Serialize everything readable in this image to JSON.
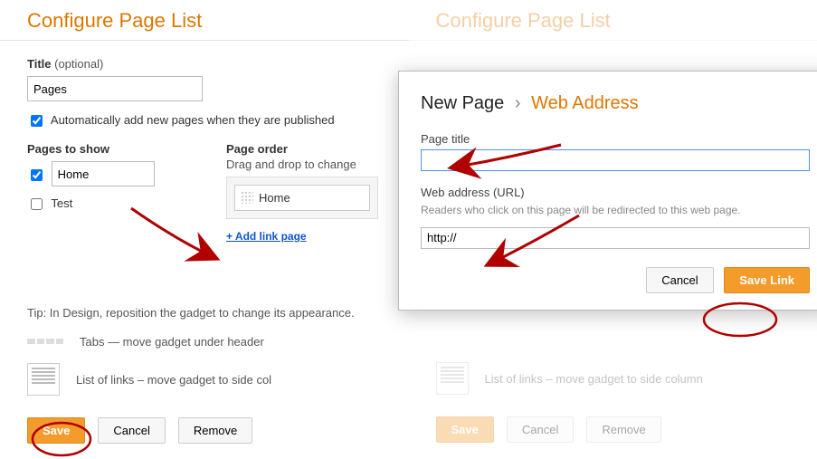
{
  "left": {
    "heading": "Configure Page List",
    "title_label": "Title",
    "title_optional": "(optional)",
    "title_value": "Pages",
    "auto_add_label": "Automatically add new pages when they are published",
    "auto_add_checked": true,
    "pages_to_show_label": "Pages to show",
    "page_order_label": "Page order",
    "page_order_hint": "Drag and drop to change",
    "pages": [
      {
        "name": "Home",
        "checked": true
      },
      {
        "name": "Test",
        "checked": false
      }
    ],
    "order_items": [
      "Home"
    ],
    "add_link_text": "+ Add link page",
    "tip": "Tip: In Design, reposition the gadget to change its appearance.",
    "layout_tabs_text": "Tabs — move gadget under header",
    "layout_links_text": "List of links – move gadget to side col",
    "save": "Save",
    "cancel": "Cancel",
    "remove": "Remove"
  },
  "right": {
    "heading": "Configure Page List",
    "layout_links_text": "List of links – move gadget to side column",
    "save": "Save",
    "cancel": "Cancel",
    "remove": "Remove"
  },
  "modal": {
    "crumb_new_page": "New Page",
    "crumb_sep": "›",
    "crumb_web_address": "Web Address",
    "page_title_label": "Page title",
    "page_title_value": "",
    "url_label": "Web address (URL)",
    "url_hint": "Readers who click on this page will be redirected to this web page.",
    "url_value": "http://",
    "cancel": "Cancel",
    "save_link": "Save Link"
  }
}
